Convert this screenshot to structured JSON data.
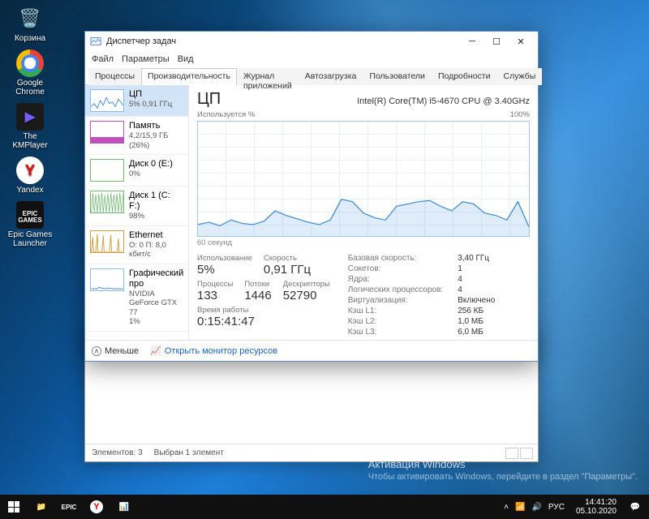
{
  "desktop_icons": [
    {
      "id": "recycle",
      "label": "Корзина"
    },
    {
      "id": "chrome",
      "label": "Google Chrome"
    },
    {
      "id": "kmplayer",
      "label": "The KMPlayer"
    },
    {
      "id": "yandex",
      "label": "Yandex"
    },
    {
      "id": "epic",
      "label": "Epic Games Launcher"
    }
  ],
  "watermark": {
    "title": "Активация Windows",
    "body": "Чтобы активировать Windows, перейдите в раздел \"Параметры\"."
  },
  "taskbar": {
    "tray": {
      "chevron": "˄",
      "net": "⬆",
      "vol": "🔊",
      "lang": "РУС"
    },
    "clock": {
      "time": "14:41:20",
      "date": "05.10.2020"
    }
  },
  "explorer": {
    "status_items": "Элементов: 3",
    "status_sel": "Выбран 1 элемент"
  },
  "tm": {
    "title": "Диспетчер задач",
    "menu": [
      "Файл",
      "Параметры",
      "Вид"
    ],
    "tabs": [
      "Процессы",
      "Производительность",
      "Журнал приложений",
      "Автозагрузка",
      "Пользователи",
      "Подробности",
      "Службы"
    ],
    "active_tab": 1,
    "sidebar": [
      {
        "id": "cpu",
        "title": "ЦП",
        "sub": "5% 0,91 ГГц",
        "active": true
      },
      {
        "id": "mem",
        "title": "Память",
        "sub": "4,2/15,9 ГБ (26%)"
      },
      {
        "id": "disk0",
        "title": "Диск 0 (E:)",
        "sub": "0%"
      },
      {
        "id": "disk1",
        "title": "Диск 1 (C: F:)",
        "sub": "98%"
      },
      {
        "id": "eth",
        "title": "Ethernet",
        "sub": "О: 0 П: 8,0 кбит/с"
      },
      {
        "id": "gpu",
        "title": "Графический про",
        "sub": "NVIDIA GeForce GTX 77",
        "sub2": "1%"
      }
    ],
    "main": {
      "heading": "ЦП",
      "cpu_name": "Intel(R) Core(TM) i5-4670 CPU @ 3.40GHz",
      "chart_ylabel": "Используется %",
      "chart_ymax": "100%",
      "chart_xlabel": "60 секунд",
      "stat_labels": {
        "usage": "Использование",
        "speed": "Скорость",
        "proc": "Процессы",
        "threads": "Потоки",
        "handles": "Дескрипторы",
        "uptime": "Время работы"
      },
      "stat_values": {
        "usage": "5%",
        "speed": "0,91 ГГц",
        "proc": "133",
        "threads": "1446",
        "handles": "52790",
        "uptime": "0:15:41:47"
      },
      "kv": [
        [
          "Базовая скорость:",
          "3,40 ГГц"
        ],
        [
          "Сокетов:",
          "1"
        ],
        [
          "Ядра:",
          "4"
        ],
        [
          "Логических процессоров:",
          "4"
        ],
        [
          "Виртуализация:",
          "Включено"
        ],
        [
          "Кэш L1:",
          "256 КБ"
        ],
        [
          "Кэш L2:",
          "1,0 МБ"
        ],
        [
          "Кэш L3:",
          "6,0 МБ"
        ]
      ]
    },
    "footer": {
      "less": "Меньше",
      "rmon": "Открыть монитор ресурсов"
    }
  },
  "chart_data": {
    "type": "line",
    "title": "ЦП — Используется %",
    "xlabel": "60 секунд",
    "ylabel": "%",
    "ylim": [
      0,
      100
    ],
    "x": [
      0,
      2,
      4,
      6,
      8,
      10,
      12,
      14,
      16,
      18,
      20,
      22,
      24,
      26,
      28,
      30,
      32,
      34,
      36,
      38,
      40,
      42,
      44,
      46,
      48,
      50,
      52,
      54,
      56,
      58,
      60
    ],
    "values": [
      10,
      12,
      9,
      14,
      11,
      10,
      13,
      22,
      18,
      15,
      12,
      10,
      14,
      32,
      30,
      20,
      16,
      14,
      26,
      28,
      30,
      31,
      26,
      22,
      30,
      28,
      20,
      18,
      14,
      30,
      8
    ]
  }
}
